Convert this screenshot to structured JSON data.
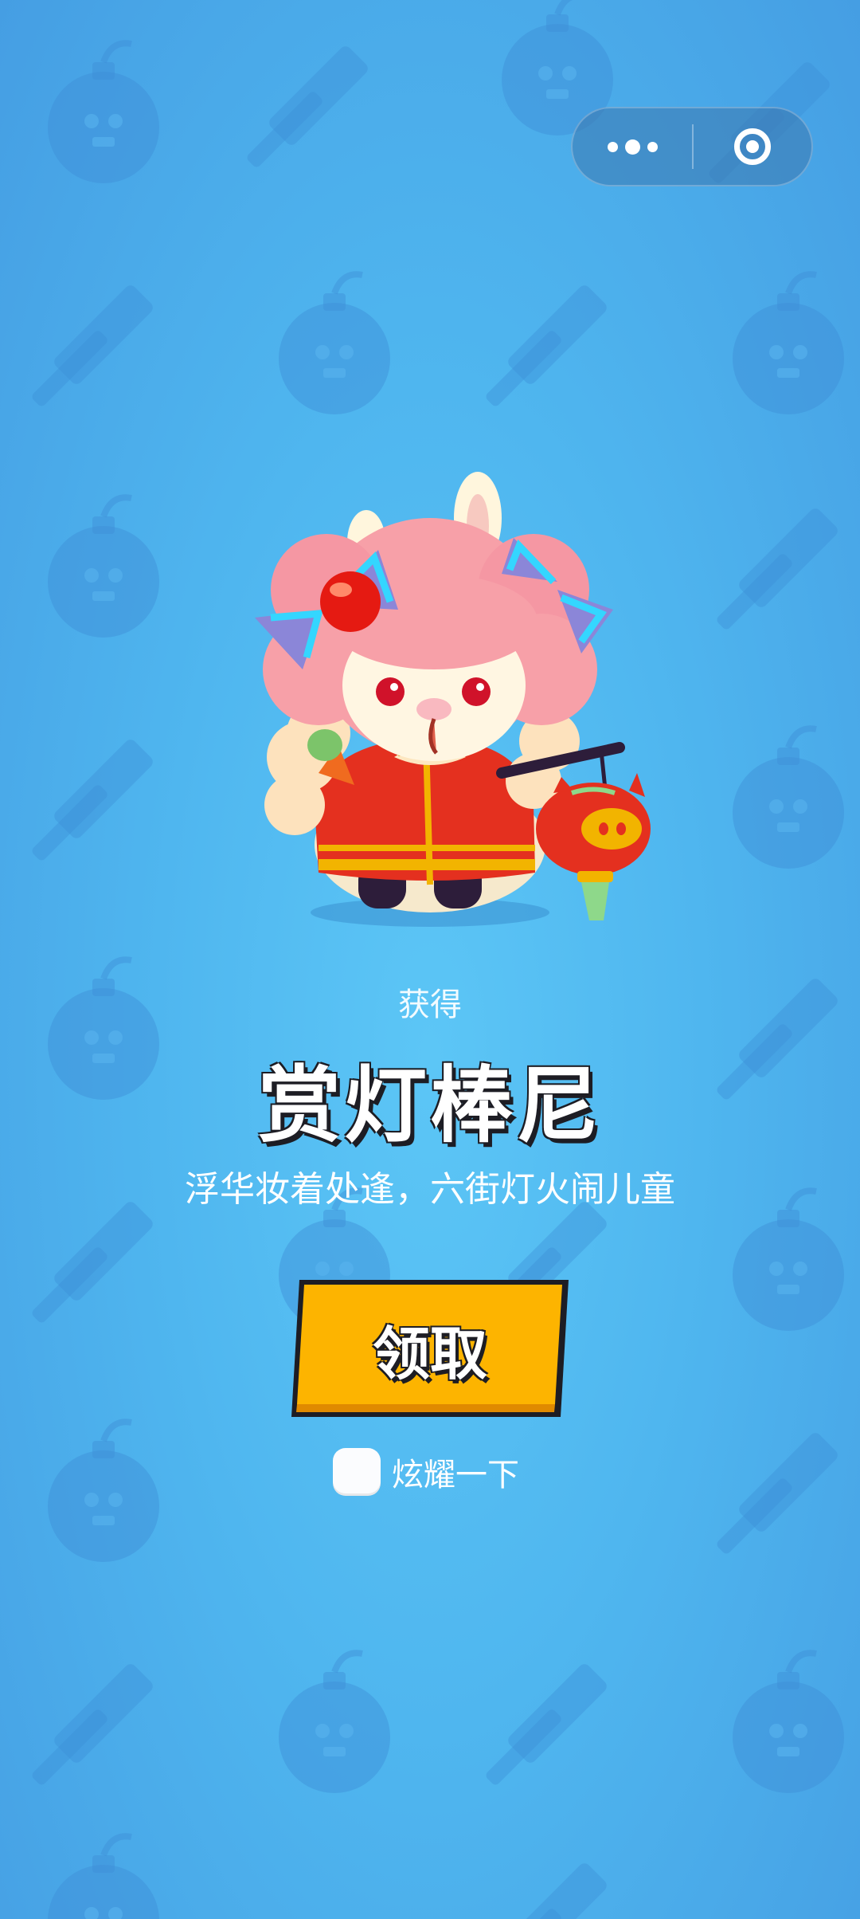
{
  "capsule": {
    "more_icon": "more-dots-icon",
    "close_icon": "target-close-icon"
  },
  "reward": {
    "obtain_label": "获得",
    "item_name": "赏灯棒尼",
    "item_description": "浮华妆着处逢，六街灯火闹儿童",
    "character_icon": "bunny-lantern-character"
  },
  "actions": {
    "claim_label": "领取",
    "share_label": "炫耀一下",
    "share_checked": false
  },
  "colors": {
    "background": "#4fb6ef",
    "button": "#fdb400",
    "button_shadow": "#e08a00",
    "outline": "#1d1d24"
  }
}
